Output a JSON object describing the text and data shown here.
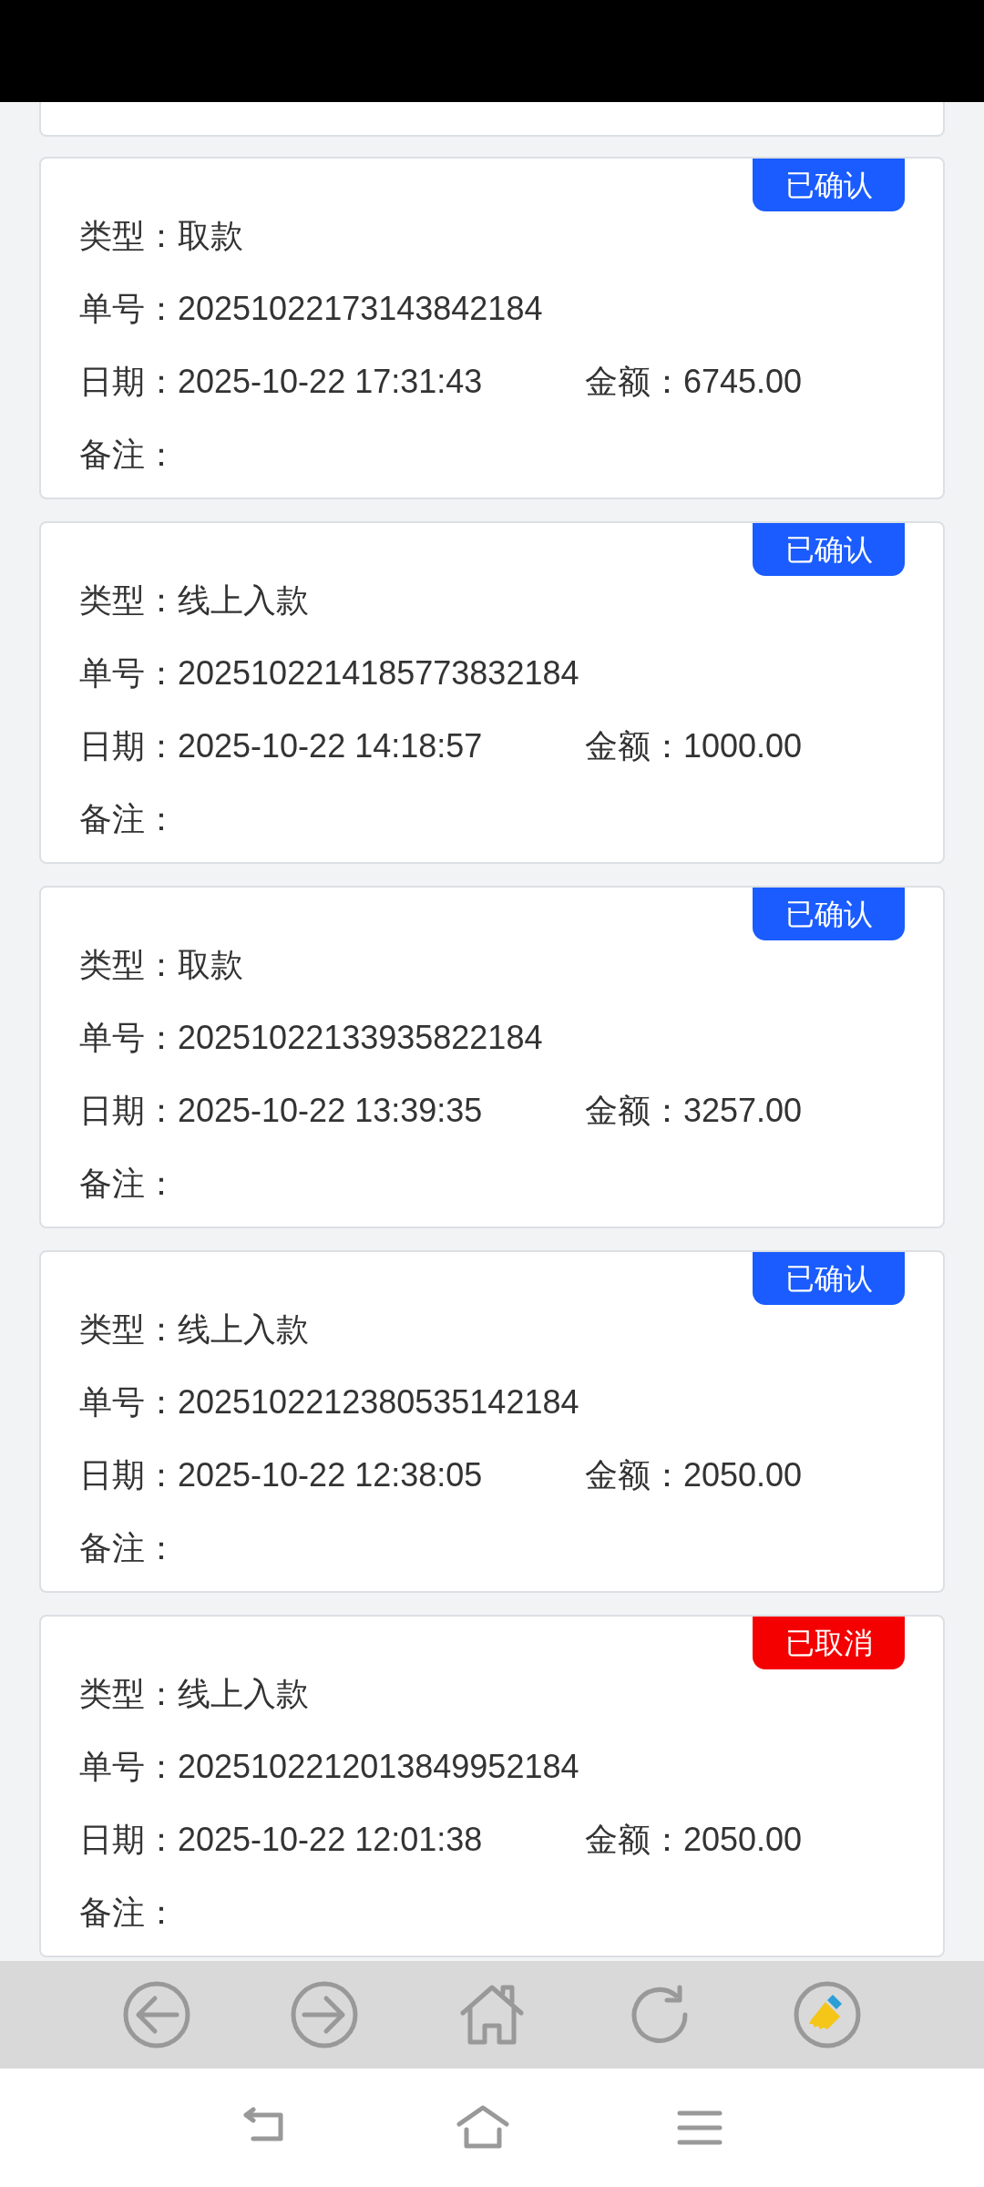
{
  "records": [
    {
      "status": {
        "label": "已确认",
        "kind": "confirmed"
      },
      "type_label": "类型：",
      "type": "取款",
      "number_label": "单号：",
      "number": "20251022173143842184",
      "date_label": "日期：",
      "date": "2025-10-22 17:31:43",
      "amount_label": "金额：",
      "amount": "6745.00",
      "note_label": "备注："
    },
    {
      "status": {
        "label": "已确认",
        "kind": "confirmed"
      },
      "type_label": "类型：",
      "type": "线上入款",
      "number_label": "单号：",
      "number": "2025102214185773832184",
      "date_label": "日期：",
      "date": "2025-10-22 14:18:57",
      "amount_label": "金额：",
      "amount": "1000.00",
      "note_label": "备注："
    },
    {
      "status": {
        "label": "已确认",
        "kind": "confirmed"
      },
      "type_label": "类型：",
      "type": "取款",
      "number_label": "单号：",
      "number": "20251022133935822184",
      "date_label": "日期：",
      "date": "2025-10-22 13:39:35",
      "amount_label": "金额：",
      "amount": "3257.00",
      "note_label": "备注："
    },
    {
      "status": {
        "label": "已确认",
        "kind": "confirmed"
      },
      "type_label": "类型：",
      "type": "线上入款",
      "number_label": "单号：",
      "number": "2025102212380535142184",
      "date_label": "日期：",
      "date": "2025-10-22 12:38:05",
      "amount_label": "金额：",
      "amount": "2050.00",
      "note_label": "备注："
    },
    {
      "status": {
        "label": "已取消",
        "kind": "cancelled"
      },
      "type_label": "类型：",
      "type": "线上入款",
      "number_label": "单号：",
      "number": "2025102212013849952184",
      "date_label": "日期：",
      "date": "2025-10-22 12:01:38",
      "amount_label": "金额：",
      "amount": "2050.00",
      "note_label": "备注："
    }
  ]
}
